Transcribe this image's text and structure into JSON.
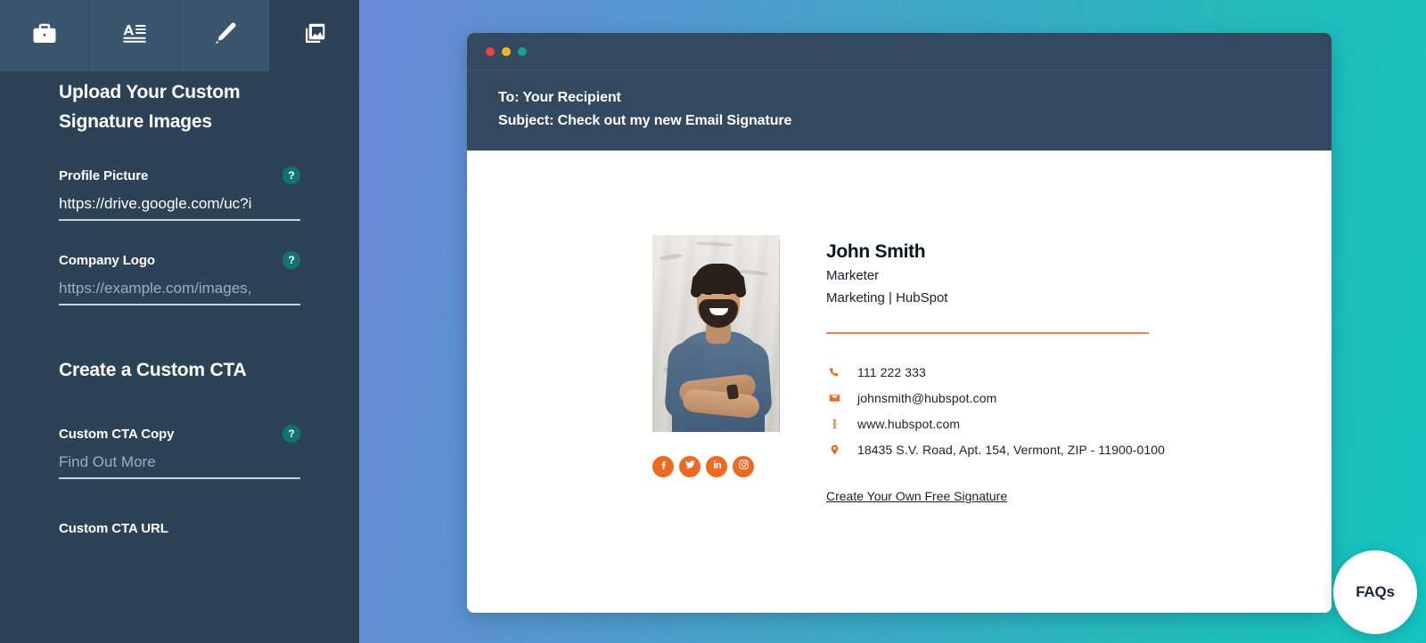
{
  "sidebar": {
    "tabs": [
      {
        "icon": "briefcase-icon",
        "name": "tab-details",
        "active": false
      },
      {
        "icon": "text-format-icon",
        "name": "tab-typography",
        "active": false
      },
      {
        "icon": "brush-icon",
        "name": "tab-style",
        "active": false
      },
      {
        "icon": "images-icon",
        "name": "tab-images",
        "active": true
      }
    ],
    "upload_section": {
      "title": "Upload Your Custom Signature Images",
      "fields": [
        {
          "label": "Profile Picture",
          "value": "https://drive.google.com/uc?i",
          "placeholder": "",
          "help": "?"
        },
        {
          "label": "Company Logo",
          "value": "",
          "placeholder": "https://example.com/images,",
          "help": "?"
        }
      ]
    },
    "cta_section": {
      "title": "Create a Custom CTA",
      "fields": [
        {
          "label": "Custom CTA Copy",
          "value": "",
          "placeholder": "Find Out More",
          "help": "?"
        },
        {
          "label": "Custom CTA URL",
          "value": "",
          "placeholder": "",
          "help": ""
        }
      ]
    }
  },
  "email_window": {
    "traffic_lights": [
      "red",
      "yellow",
      "green"
    ],
    "to_line": "To: Your Recipient",
    "subject_line": "Subject: Check out my new Email Signature",
    "signature": {
      "photo_alt": "Smiling bearded man with crossed arms in blue t-shirt",
      "name": "John Smith",
      "job_title": "Marketer",
      "department_company": "Marketing | HubSpot",
      "divider_color": "#ef8150",
      "contacts": [
        {
          "icon": "phone-icon",
          "text": "111 222 333"
        },
        {
          "icon": "email-icon",
          "text": "johnsmith@hubspot.com"
        },
        {
          "icon": "website-icon",
          "text": "www.hubspot.com"
        },
        {
          "icon": "location-pin-icon",
          "text": "18435 S.V. Road, Apt. 154, Vermont, ZIP - 11900-0100"
        }
      ],
      "social": [
        {
          "icon": "facebook-icon",
          "name": "social-facebook"
        },
        {
          "icon": "twitter-icon",
          "name": "social-twitter"
        },
        {
          "icon": "linkedin-icon",
          "name": "social-linkedin"
        },
        {
          "icon": "instagram-icon",
          "name": "social-instagram"
        }
      ],
      "cta_link": "Create Your Own Free Signature"
    }
  },
  "faq_button": {
    "label": "FAQs"
  },
  "colors": {
    "sidebar_bg": "#2c4256",
    "tab_bg": "#3b556f",
    "tab_active_bg": "#2c4256",
    "accent_orange": "#ec6a21",
    "divider_orange": "#ef8150",
    "help_badge_teal": "#12736f",
    "window_header": "#32495f",
    "gradient_left": "#6b8ad6",
    "gradient_right": "#15c4c0"
  }
}
